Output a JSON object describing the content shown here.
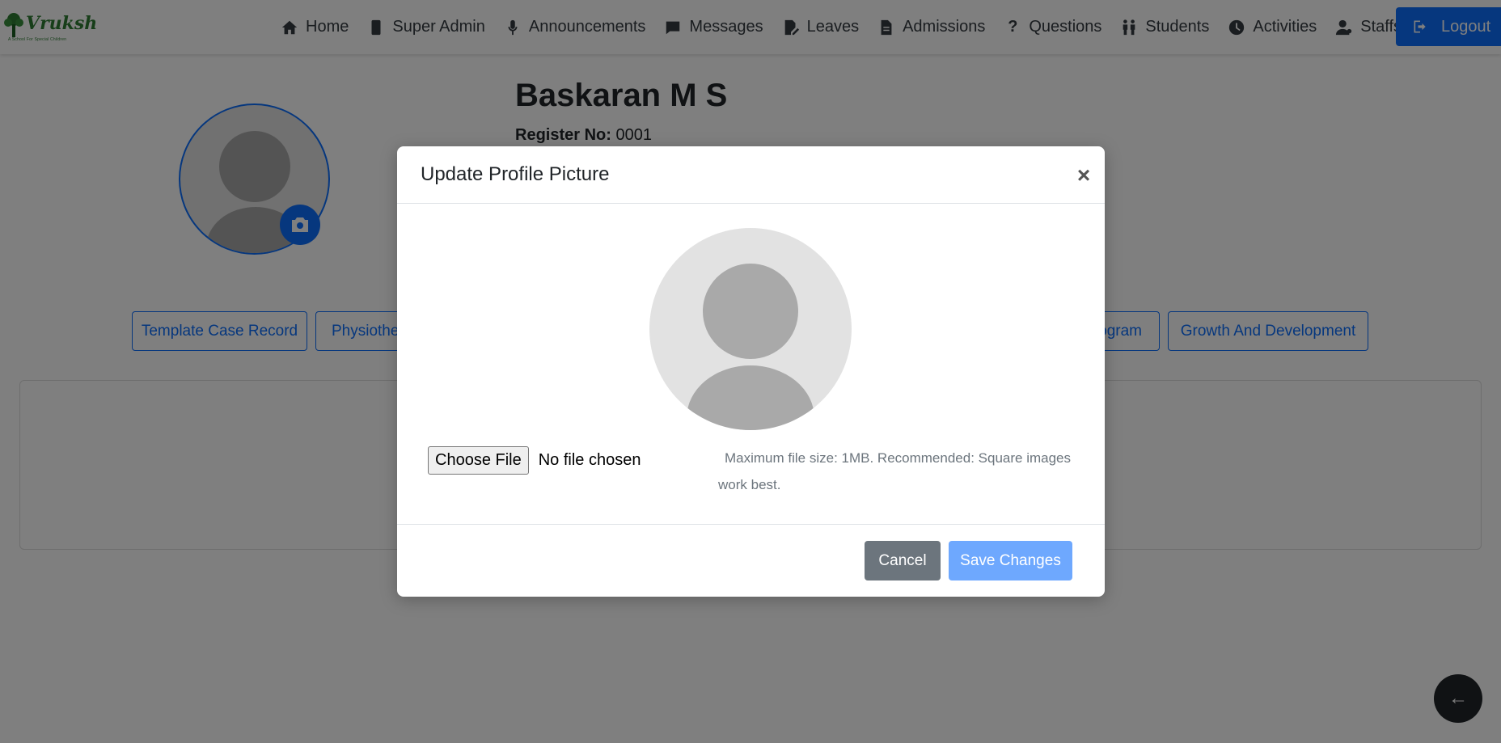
{
  "app": {
    "logo_text": "Vruksh",
    "logo_tagline": "A School For Special Children"
  },
  "nav": {
    "items": [
      {
        "label": "Home",
        "icon": "home-icon"
      },
      {
        "label": "Super Admin",
        "icon": "phone-icon"
      },
      {
        "label": "Announcements",
        "icon": "microphone-icon"
      },
      {
        "label": "Messages",
        "icon": "message-icon"
      },
      {
        "label": "Leaves",
        "icon": "file-edit-icon"
      },
      {
        "label": "Admissions",
        "icon": "document-icon"
      },
      {
        "label": "Questions",
        "icon": "question-icon"
      },
      {
        "label": "Students",
        "icon": "students-icon"
      },
      {
        "label": "Activities",
        "icon": "clock-icon"
      },
      {
        "label": "Staffs",
        "icon": "staff-icon"
      }
    ],
    "bell_icon": "bell-icon",
    "logout_label": "Logout"
  },
  "profile": {
    "name": "Baskaran M S",
    "register_label": "Register No:",
    "register_value": "0001"
  },
  "tabs": {
    "items": [
      {
        "label": "Template Case Record"
      },
      {
        "label": "Physiotherapy"
      },
      {
        "label": "Program"
      },
      {
        "label": "Growth And Development"
      }
    ]
  },
  "modal": {
    "title": "Update Profile Picture",
    "close_symbol": "×",
    "choose_file_label": "Choose File",
    "no_file_text": "No file chosen",
    "help_text": "Maximum file size: 1MB. Recommended: Square images work best.",
    "cancel_label": "Cancel",
    "save_label": "Save Changes"
  },
  "fab": {
    "back_symbol": "←"
  },
  "colors": {
    "primary": "#0d6efd",
    "primary_light": "#6ea8fe",
    "secondary": "#6c757d",
    "dark": "#212529"
  }
}
